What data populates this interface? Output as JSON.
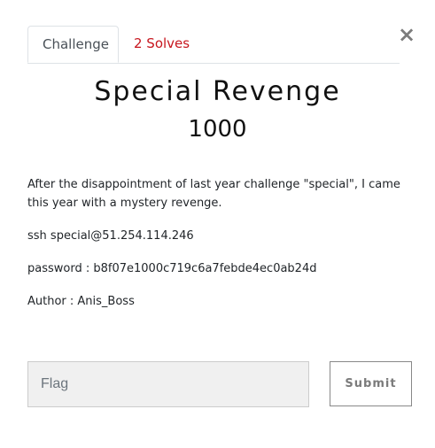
{
  "modal": {
    "close_label": "×",
    "tabs": [
      {
        "label": "Challenge",
        "active": true
      },
      {
        "label": "2 Solves",
        "active": false
      }
    ],
    "title": "Special Revenge",
    "value": "1000",
    "description": [
      "After the disappointment of last year challenge \"special\", I came this year with a mystery revenge.",
      "ssh special@51.254.114.246",
      "password : b8f07e1000c719c6a7febde4ec0ab24d",
      "Author : Anis_Boss"
    ],
    "flag_input": {
      "placeholder": "Flag",
      "value": ""
    },
    "submit_label": "Submit"
  },
  "colors": {
    "accent": "#c7161e",
    "tab_border": "#dee2e6",
    "input_bg": "#f0f0f0"
  }
}
